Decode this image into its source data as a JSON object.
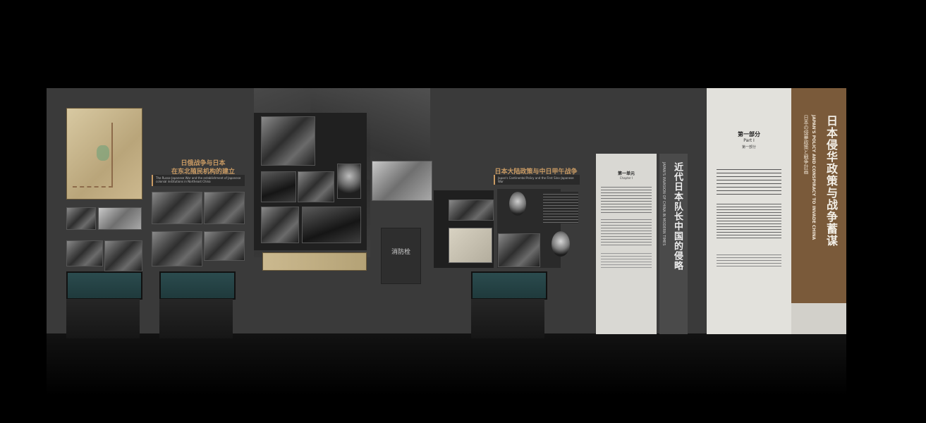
{
  "section_russo_japanese": {
    "title_line1": "日俄战争与日本",
    "title_line2": "在东北殖民机构的建立",
    "en_title": "The Russo-Japanese War and the establishment of Japanese colonial institutions in Northeast China"
  },
  "section_continental": {
    "title": "日本大陆政策与中日甲午战争",
    "en_title": "Japan's Continental Policy and the First Sino-Japanese War"
  },
  "fire_hydrant_label": "消防栓",
  "chapter_panel": {
    "heading": "第一单元",
    "subheading": "Chapter I"
  },
  "chapter_banner": {
    "cn": "近代日本队长中国的侵略",
    "en": "JAPAN'S INVASION OF CHINA IN MODERN TIMES"
  },
  "part_panel": {
    "heading": "第一部分",
    "part_en": "Part I",
    "sub": "第一部分"
  },
  "main_banner": {
    "cn": "日本侵华政策与战争蓄谋",
    "en": "JAPAN'S POLICY AND CONSPIRACY TO INVADE CHINA",
    "sub_cn": "日本の侵華政策と戦争計画"
  },
  "colors": {
    "wall": "#3a3a3a",
    "gold_text": "#c99a63",
    "banner_brown": "#7a5a3a",
    "panel_light": "#d9d8d3"
  }
}
